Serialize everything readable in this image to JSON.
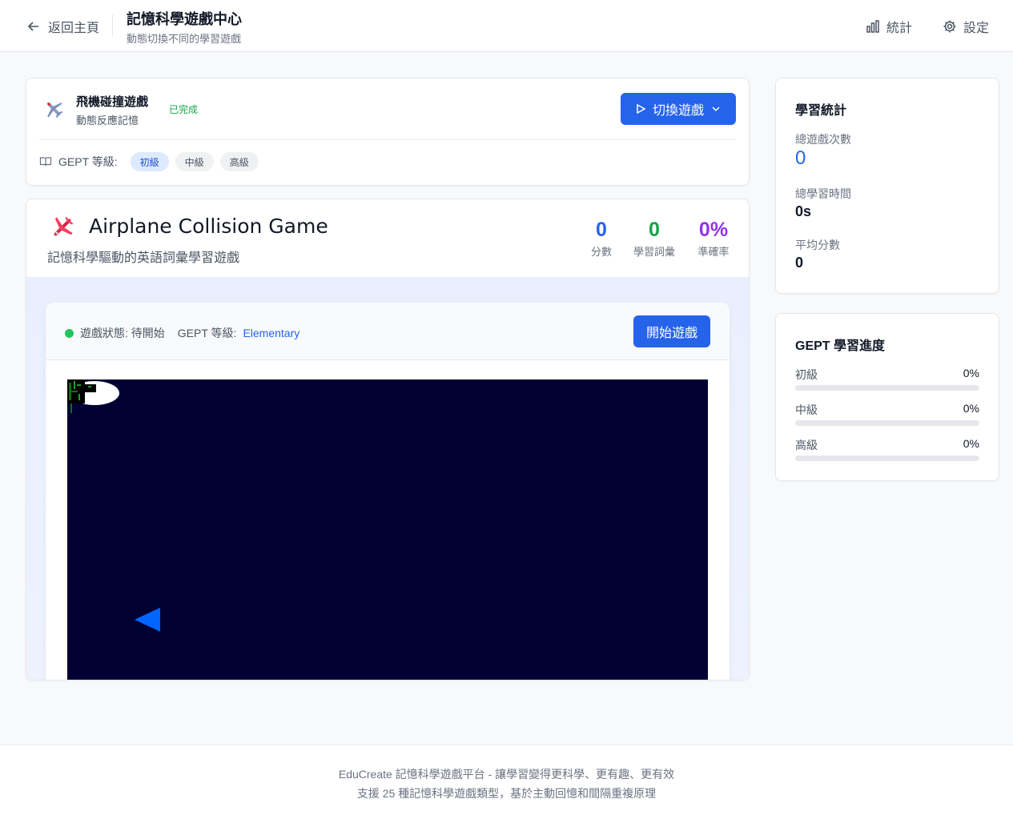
{
  "header": {
    "back_label": "返回主頁",
    "title": "記憶科學遊戲中心",
    "subtitle": "動態切換不同的學習遊戲",
    "stats_label": "統計",
    "settings_label": "設定"
  },
  "game_selector": {
    "game_name": "飛機碰撞遊戲",
    "game_desc": "動態反應記憶",
    "status": "已完成",
    "switch_label": "切換遊戲",
    "gept_label": "GEPT 等級:",
    "levels": [
      "初級",
      "中級",
      "高級"
    ],
    "active_level": "初級"
  },
  "game": {
    "title": "Airplane Collision Game",
    "subtitle": "記憶科學驅動的英語詞彙學習遊戲",
    "stats": [
      {
        "value": "0",
        "label": "分數",
        "color": "#2563eb"
      },
      {
        "value": "0",
        "label": "學習詞彙",
        "color": "#16a34a"
      },
      {
        "value": "0%",
        "label": "準確率",
        "color": "#9333ea"
      }
    ],
    "status_label": "遊戲狀態: 待開始",
    "gept_label": "GEPT 等級:",
    "gept_level": "Elementary",
    "start_label": "開始遊戲",
    "canvas_bg": "#000033"
  },
  "learning_stats": {
    "title": "學習統計",
    "total_games_label": "總遊戲次數",
    "total_games": "0",
    "total_time_label": "總學習時間",
    "total_time": "0s",
    "avg_score_label": "平均分數",
    "avg_score": "0"
  },
  "gept_progress": {
    "title": "GEPT 學習進度",
    "levels": [
      {
        "label": "初級",
        "percent": "0%",
        "fraction": 0
      },
      {
        "label": "中級",
        "percent": "0%",
        "fraction": 0
      },
      {
        "label": "高級",
        "percent": "0%",
        "fraction": 0
      }
    ]
  },
  "footer": {
    "line1": "EduCreate 記憶科學遊戲平台 - 讓學習變得更科學、更有趣、更有效",
    "line2": "支援 25 種記憶科學遊戲類型，基於主動回憶和間隔重複原理"
  }
}
